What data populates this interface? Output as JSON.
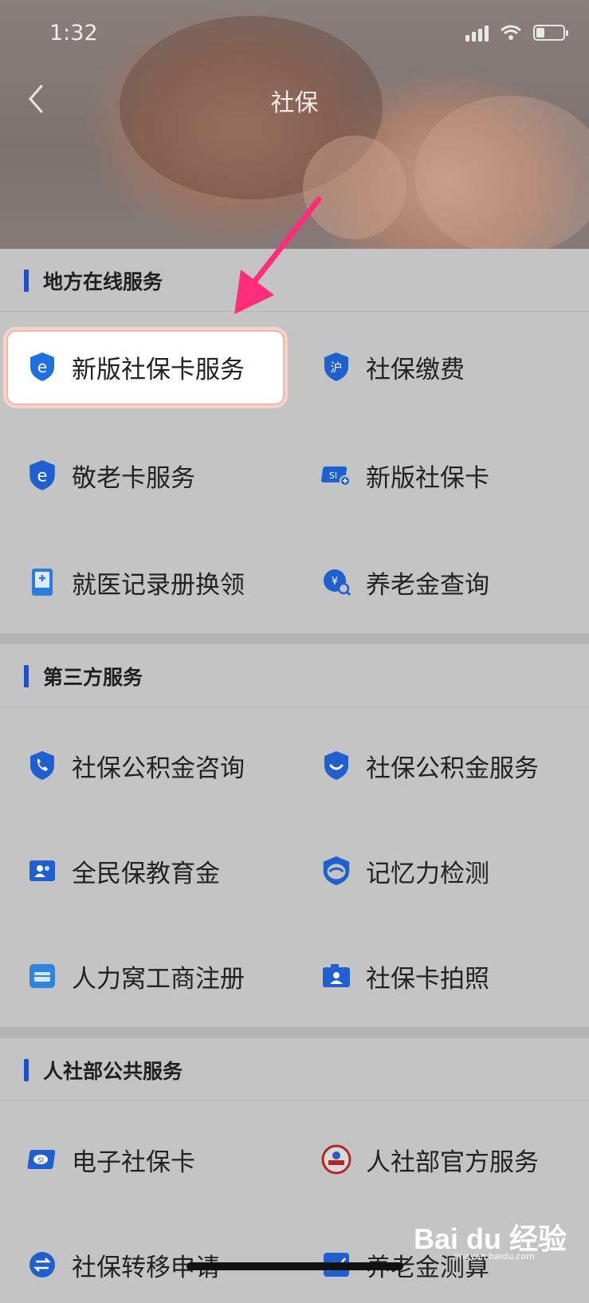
{
  "status": {
    "time": "1:32"
  },
  "header": {
    "title": "社保"
  },
  "sections": [
    {
      "title": "地方在线服务",
      "items": [
        {
          "label": "新版社保卡服务",
          "icon": "shield-e-icon"
        },
        {
          "label": "社保缴费",
          "icon": "shield-hu-icon"
        },
        {
          "label": "敬老卡服务",
          "icon": "shield-e-icon"
        },
        {
          "label": "新版社保卡",
          "icon": "si-card-icon"
        },
        {
          "label": "就医记录册换领",
          "icon": "medical-book-icon"
        },
        {
          "label": "养老金查询",
          "icon": "pension-search-icon"
        }
      ]
    },
    {
      "title": "第三方服务",
      "items": [
        {
          "label": "社保公积金咨询",
          "icon": "shield-phone-icon"
        },
        {
          "label": "社保公积金服务",
          "icon": "shield-smile-icon"
        },
        {
          "label": "全民保教育金",
          "icon": "person-card-icon"
        },
        {
          "label": "记忆力检测",
          "icon": "brain-shield-icon"
        },
        {
          "label": "人力窝工商注册",
          "icon": "briefcase-icon"
        },
        {
          "label": "社保卡拍照",
          "icon": "camera-id-icon"
        }
      ]
    },
    {
      "title": "人社部公共服务",
      "items": [
        {
          "label": "电子社保卡",
          "icon": "si-card-icon"
        },
        {
          "label": "人社部官方服务",
          "icon": "official-seal-icon"
        },
        {
          "label": "社保转移申请",
          "icon": "transfer-icon"
        },
        {
          "label": "养老金测算",
          "icon": "chart-icon"
        }
      ]
    }
  ],
  "watermark": {
    "main": "Bai du 经验",
    "sub": "jingyan.baidu.com"
  },
  "colors": {
    "accent": "#1f4fd1",
    "arrow": "#ff2d7a",
    "highlight_border": "#f2b5a8"
  }
}
